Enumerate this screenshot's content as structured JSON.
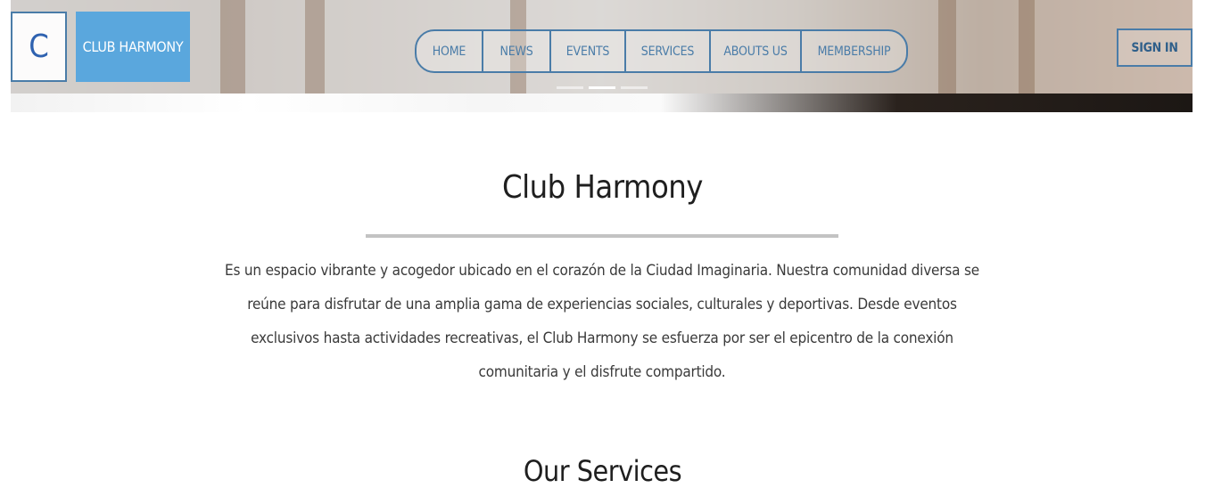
{
  "header": {
    "logo_letter": "C",
    "brand_name": "CLUB HARMONY",
    "nav_items": [
      "HOME",
      "NEWS",
      "EVENTS",
      "SERVICES",
      "ABOUTS US",
      "MEMBERSHIP"
    ],
    "sign_in_label": "SIGN IN"
  },
  "hero": {
    "slide_count": 3,
    "active_slide": 2
  },
  "main": {
    "title": "Club Harmony",
    "description": "Es un espacio vibrante y acogedor ubicado en el corazón de la Ciudad Imaginaria. Nuestra comunidad diversa se reúne para disfrutar de una amplia gama de experiencias sociales, culturales y deportivas. Desde eventos exclusivos hasta actividades recreativas, el Club Harmony se esfuerza por ser el epicentro de la conexión comunitaria y el disfrute compartido.",
    "services_heading": "Our Services"
  },
  "colors": {
    "accent": "#4a7ca8",
    "brand_bg": "#5aa7dd",
    "logo_letter": "#2f62b0",
    "divider": "#c3c3c3"
  }
}
